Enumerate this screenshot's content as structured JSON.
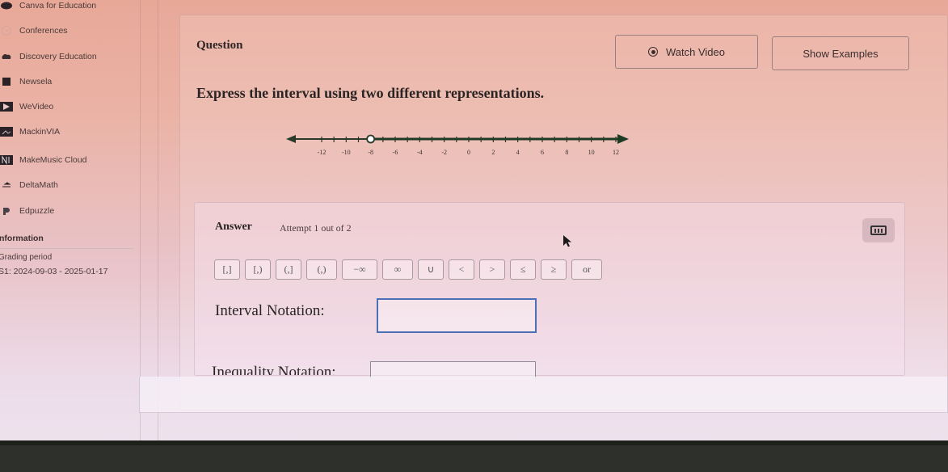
{
  "sidebar": {
    "items": [
      {
        "label": "Canva for Education",
        "icon": "canva-icon"
      },
      {
        "label": "Conferences",
        "icon": "conferences-icon"
      },
      {
        "label": "Discovery Education",
        "icon": "discovery-education-icon"
      },
      {
        "label": "Newsela",
        "icon": "newsela-icon"
      },
      {
        "label": "WeVideo",
        "icon": "wevideo-icon"
      },
      {
        "label": "MackinVIA",
        "icon": "mackinvia-icon"
      },
      {
        "label": "MakeMusic Cloud",
        "icon": "makemusic-icon"
      },
      {
        "label": "DeltaMath",
        "icon": "deltamath-icon"
      },
      {
        "label": "Edpuzzle",
        "icon": "edpuzzle-icon"
      }
    ],
    "info_heading": "nformation",
    "grading_label": "Grading period",
    "grading_value": "S1: 2024-09-03 - 2025-01-17"
  },
  "question": {
    "title": "Question",
    "watch_video_label": "Watch Video",
    "show_examples_label": "Show Examples",
    "prompt": "Express the interval using two different representations."
  },
  "number_line": {
    "min": -12,
    "max": 12,
    "tick_step": 1,
    "label_step": 2,
    "tick_labels": [
      "-12",
      "-10",
      "-8",
      "-6",
      "-4",
      "-2",
      "0",
      "2",
      "4",
      "6",
      "8",
      "10",
      "12"
    ],
    "endpoint": -8,
    "endpoint_type": "open",
    "shaded_direction": "right",
    "line_color": "#2a3a2a",
    "arrow_color": "#1f3a24"
  },
  "answer": {
    "title": "Answer",
    "attempt": "Attempt 1 out of 2",
    "symbols": [
      "[,]",
      "[,)",
      "(,]",
      "(,)",
      "−∞",
      "∞",
      "∪",
      "<",
      ">",
      "≤",
      "≥",
      "or"
    ],
    "interval_label": "Interval Notation:",
    "interval_value": "",
    "inequality_label": "Inequality Notation:",
    "inequality_value": ""
  },
  "colors": {
    "input_focus": "#4a6fb5",
    "bezel": "#2e312b"
  }
}
